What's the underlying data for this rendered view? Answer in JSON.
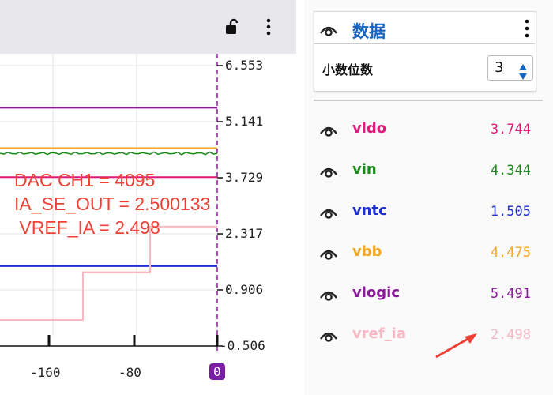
{
  "header": {
    "lock_icon": "unlock-icon",
    "menu_icon": "vertical-ellipsis-icon"
  },
  "chart_data": {
    "type": "line",
    "y_ticks": [
      "6.553",
      "5.141",
      "3.729",
      "2.317",
      "0.906",
      "-0.506"
    ],
    "x_ticks": [
      "-160",
      "-80",
      "0"
    ],
    "ylim": [
      -0.506,
      6.553
    ],
    "annotations": [
      "DAC CH1 = 4095",
      "IA_SE_OUT = 2.500133",
      " VREF_IA = 2.498"
    ],
    "series": [
      {
        "name": "vlogic",
        "color": "#8b1a9b",
        "values": [
          5.491
        ]
      },
      {
        "name": "vbb",
        "color": "#f5a623",
        "values": [
          4.475
        ]
      },
      {
        "name": "vin",
        "color": "#1a8a1a",
        "values": [
          4.344
        ]
      },
      {
        "name": "vldo",
        "color": "#e0197a",
        "values": [
          3.744
        ]
      },
      {
        "name": "vntc",
        "color": "#1f2fd0",
        "values": [
          1.505
        ]
      },
      {
        "name": "vref_ia",
        "color": "#f7b9c4",
        "values": [
          2.498
        ]
      }
    ]
  },
  "panel": {
    "title": "数据",
    "decimals_label": "小数位数",
    "decimals_value": "3",
    "signals": [
      {
        "name": "vldo",
        "value": "3.744",
        "color": "#e0197a"
      },
      {
        "name": "vin",
        "value": "4.344",
        "color": "#1a8a1a"
      },
      {
        "name": "vntc",
        "value": "1.505",
        "color": "#1f2fd0"
      },
      {
        "name": "vbb",
        "value": "4.475",
        "color": "#f5a623"
      },
      {
        "name": "vlogic",
        "value": "5.491",
        "color": "#8b1a9b"
      },
      {
        "name": "vref_ia",
        "value": "2.498",
        "color": "#f7b9c4"
      }
    ]
  }
}
